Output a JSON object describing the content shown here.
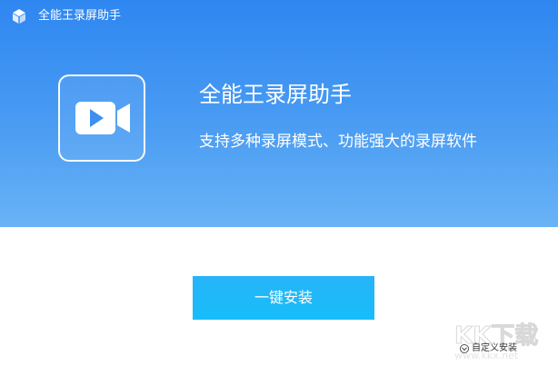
{
  "window": {
    "title": "全能王录屏助手",
    "logo_icon": "cube-icon"
  },
  "hero": {
    "app_icon": "video-camera-icon",
    "app_name": "全能王录屏助手",
    "tagline": "支持多种录屏模式、功能强大的录屏软件",
    "gradient_top": "#2e86f0",
    "gradient_bottom": "#69b3f6"
  },
  "install": {
    "button_label": "一键安装",
    "button_color": "#1db8f9",
    "custom_install_label": "自定义安装",
    "custom_install_icon": "chevron-down-circle-icon"
  },
  "watermark": {
    "brand": "KK下载",
    "url": "www.kkx.net"
  }
}
